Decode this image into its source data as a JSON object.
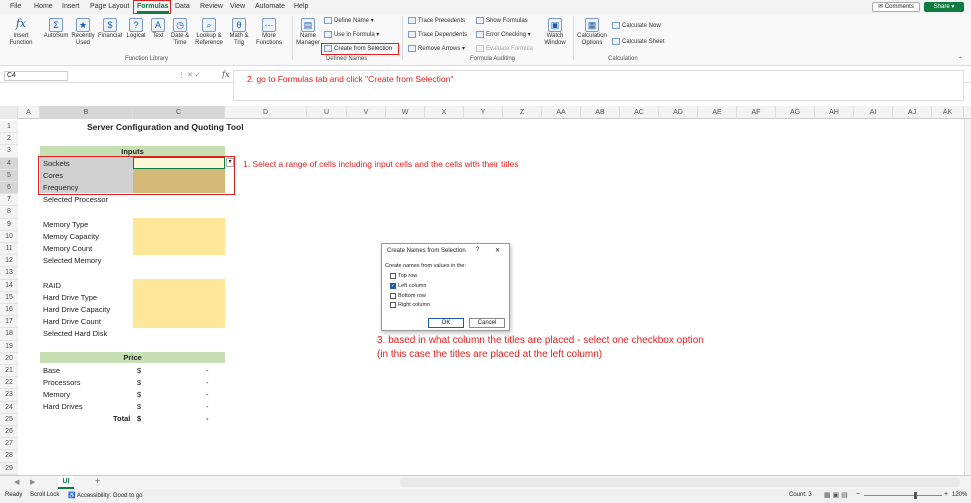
{
  "menu": {
    "tabs": [
      "File",
      "Home",
      "Insert",
      "Page Layout",
      "Formulas",
      "Data",
      "Review",
      "View",
      "Automate",
      "Help"
    ],
    "active": "Formulas",
    "comments": "Comments",
    "share": "Share"
  },
  "ribbon": {
    "function_library": {
      "insert_function": "Insert Function",
      "buttons": [
        "AutoSum",
        "Recently Used",
        "Financial",
        "Logical",
        "Text",
        "Date & Time",
        "Lookup & Reference",
        "Math & Trig",
        "More Functions"
      ],
      "group_label": "Function Library"
    },
    "defined_names": {
      "name_manager": "Name Manager",
      "define_name": "Define Name",
      "use_in_formula": "Use in Formula",
      "create_from_selection": "Create from Selection",
      "group_label": "Defined Names"
    },
    "formula_auditing": {
      "trace_precedents": "Trace Precedents",
      "trace_dependents": "Trace Dependents",
      "remove_arrows": "Remove Arrows",
      "show_formulas": "Show Formulas",
      "error_checking": "Error Checking",
      "evaluate_formula": "Evaluate Formula",
      "watch_window": "Watch Window",
      "group_label": "Formula Auditing"
    },
    "calculation": {
      "options": "Calculation Options",
      "calc_now": "Calculate Now",
      "calc_sheet": "Calculate Sheet",
      "group_label": "Calculation"
    }
  },
  "formula_bar": {
    "name_box": "C4",
    "fx": "fx"
  },
  "columns": [
    "A",
    "B",
    "C",
    "D",
    "U",
    "V",
    "W",
    "X",
    "Y",
    "Z",
    "AA",
    "AB",
    "AC",
    "AD",
    "AE",
    "AF",
    "AG",
    "AH",
    "AI",
    "AJ",
    "AK"
  ],
  "sheet": {
    "title": "Server Configuration and Quoting Tool",
    "inputs_header": "Inputs",
    "inputs": [
      "Sockets",
      "Cores",
      "Frequency",
      "Selected Processor",
      "Memory Type",
      "Memoy Capacity",
      "Memory Count",
      "Selected Memory",
      "RAID",
      "Hard Drive Type",
      "Hard Drive Capacity",
      "Hard Drive Count",
      "Selected Hard Disk"
    ],
    "price_header": "Price",
    "price_rows": [
      {
        "label": "Base",
        "cur": "$",
        "val": "-"
      },
      {
        "label": "Processors",
        "cur": "$",
        "val": "-"
      },
      {
        "label": "Memory",
        "cur": "$",
        "val": "-"
      },
      {
        "label": "Hard Drives",
        "cur": "$",
        "val": "-"
      },
      {
        "label": "Total",
        "cur": "$",
        "val": "-"
      }
    ]
  },
  "annotations": {
    "step1": "1. Select a range of cells including input cells and the cells with their titles",
    "step2": "2. go to Formulas tab and click \"Create from Selection\"",
    "step3a": "3. based in what column the titles are placed - select one checkbox option",
    "step3b": "(in this case the titles are placed at the left column)"
  },
  "dialog": {
    "title": "Create Names from Selection",
    "help": "?",
    "close": "✕",
    "prompt": "Create names from values in the:",
    "options": [
      {
        "label": "Top row",
        "checked": false
      },
      {
        "label": "Left column",
        "checked": true
      },
      {
        "label": "Bottom row",
        "checked": false
      },
      {
        "label": "Right column",
        "checked": false
      }
    ],
    "ok": "OK",
    "cancel": "Cancel"
  },
  "sheet_tabs": {
    "tab": "UI",
    "add": "+"
  },
  "status": {
    "ready": "Ready",
    "scroll_lock": "Scroll Lock",
    "accessibility": "Accessibility: Good to go",
    "count": "Count: 3",
    "zoom": "120%"
  },
  "colors": {
    "accent": "#107c41",
    "annotation": "#e02020",
    "input_fill": "#ffe699",
    "header_fill": "#c6e0b4"
  }
}
